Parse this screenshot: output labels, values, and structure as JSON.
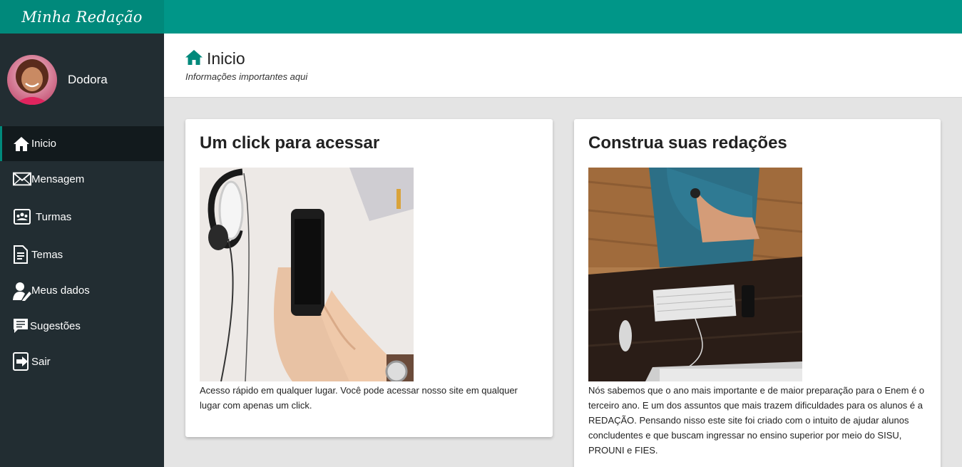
{
  "app": {
    "brand": "Minha Redação"
  },
  "user": {
    "name": "Dodora"
  },
  "sidebar": {
    "items": [
      {
        "label": "Inicio",
        "icon": "home-icon",
        "active": true
      },
      {
        "label": "Mensagem",
        "icon": "envelope-icon",
        "active": false
      },
      {
        "label": "Turmas",
        "icon": "class-group-icon",
        "active": false
      },
      {
        "label": "Temas",
        "icon": "document-icon",
        "active": false
      },
      {
        "label": "Meus dados",
        "icon": "user-edit-icon",
        "active": false
      },
      {
        "label": "Sugestões",
        "icon": "comment-icon",
        "active": false
      },
      {
        "label": "Sair",
        "icon": "logout-icon",
        "active": false
      }
    ]
  },
  "header": {
    "title": "Inicio",
    "subtitle": "Informações importantes aqui",
    "icon": "home-icon"
  },
  "cards": [
    {
      "title": "Um click para acessar",
      "image": "hands-holding-smartphone-photo",
      "text": "Acesso rápido em qualquer lugar. Você pode acessar nosso site em qualquer lugar com apenas um click."
    },
    {
      "title": "Construa suas redações",
      "image": "person-at-desk-keyboard-photo",
      "text": "Nós sabemos que o ano mais importante e de maior preparação para o Enem é o terceiro ano. E um dos assuntos que mais trazem dificuldades para os alunos é a REDAÇÃO. Pensando nisso este site foi criado com o intuito de ajudar alunos concludentes e que buscam ingressar no ensino superior por meio do SISU, PROUNI e FIES."
    }
  ],
  "colors": {
    "accent": "#009688",
    "sidebar": "#222d32",
    "sidebar_active": "#121a1d",
    "background": "#e4e4e4"
  }
}
